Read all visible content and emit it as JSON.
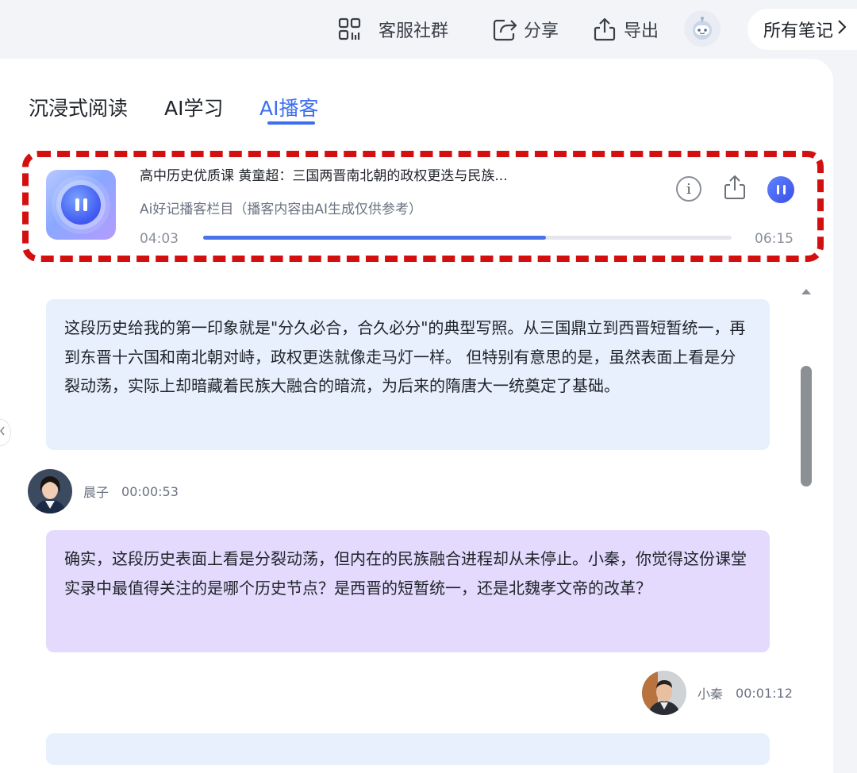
{
  "topbar": {
    "community_label": "客服社群",
    "share_label": "分享",
    "export_label": "导出",
    "all_notes_label": "所有笔记",
    "icons": [
      "grid-icon",
      "share-icon",
      "export-icon",
      "robot-avatar-icon",
      "chevron-right-icon"
    ]
  },
  "tabs": [
    {
      "label": "沉浸式阅读",
      "active": false
    },
    {
      "label": "AI学习",
      "active": false
    },
    {
      "label": "AI播客",
      "active": true
    }
  ],
  "player": {
    "title": "高中历史优质课 黄童超：三国两晋南北朝的政权更迭与民族...",
    "subtitle": "Ai好记播客栏目（播客内容由AI生成仅供参考）",
    "current_time": "04:03",
    "total_time": "06:15",
    "progress": 0.648,
    "state": "playing",
    "highlight_color": "#d40f0f",
    "accent_color": "#4b73ea"
  },
  "messages": [
    {
      "text": "这段历史给我的第一印象就是\"分久必合，合久必分\"的典型写照。从三国鼎立到西晋短暂统一，再到东晋十六国和南北朝对峙，政权更迭就像走马灯一样。 但特别有意思的是，虽然表面上看是分裂动荡，实际上却暗藏着民族大融合的暗流，为后来的隋唐大一统奠定了基础。",
      "color": "#e8f0fd"
    },
    {
      "speaker": "晨子",
      "time": "00:00:53"
    },
    {
      "text": "确实，这段历史表面上看是分裂动荡，但内在的民族融合进程却从未停止。小秦，你觉得这份课堂实录中最值得关注的是哪个历史节点？是西晋的短暂统一，还是北魏孝文帝的改革？",
      "color": "#e3dafd"
    },
    {
      "speaker": "小秦",
      "time": "00:01:12"
    }
  ]
}
